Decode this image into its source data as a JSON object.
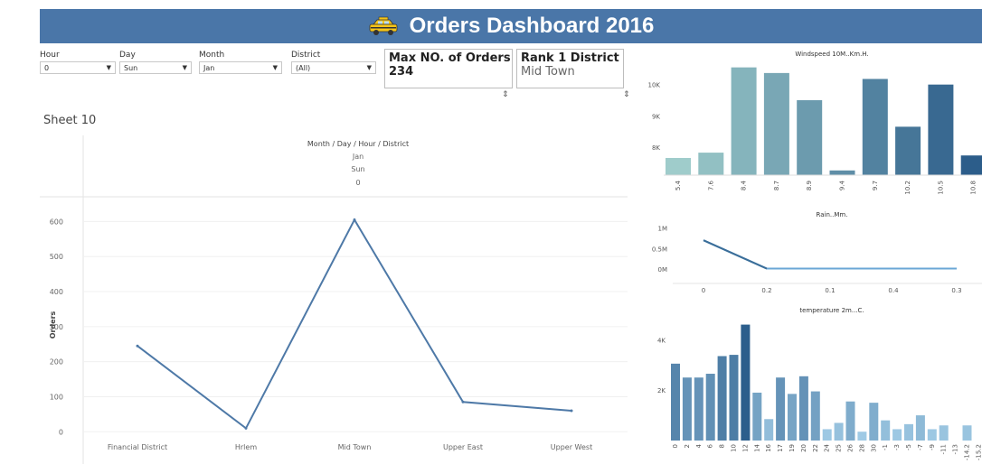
{
  "dashboard_title": "Orders Dashboard 2016",
  "filters": [
    {
      "label": "Hour",
      "value": "0"
    },
    {
      "label": "Day",
      "value": "Sun"
    },
    {
      "label": "Month",
      "value": "Jan"
    },
    {
      "label": "District",
      "value": "(All)"
    }
  ],
  "kpi": {
    "max_orders_title": "Max NO. of Orders",
    "max_orders_value": "234",
    "rank1_title": "Rank 1 District",
    "rank1_value": "Mid Town"
  },
  "sheet_title": "Sheet 10",
  "colors": {
    "banner": "#4a76a8",
    "line": "#4e79a7",
    "ramp_light": "#b3e0d6",
    "ramp_dark": "#2c5d8a"
  },
  "chart_data": [
    {
      "type": "line",
      "title": "Month / Day / Hour / District",
      "headers": [
        "Jan",
        "Sun",
        "0"
      ],
      "ylabel": "Orders",
      "categories": [
        "Financial District",
        "Hrlem",
        "Mid Town",
        "Upper East",
        "Upper West"
      ],
      "values": [
        245,
        10,
        605,
        85,
        60
      ],
      "ylim": [
        -25,
        650
      ],
      "yticks": [
        0,
        100,
        200,
        300,
        400,
        500,
        600
      ]
    },
    {
      "type": "bar",
      "title": "Windspeed 10M..Km.H.",
      "categories": [
        "5.4",
        "7.6",
        "8.4",
        "8.7",
        "8.9",
        "9.4",
        "9.7",
        "10.2",
        "10.5",
        "10.8"
      ],
      "values": [
        7650,
        7820,
        10550,
        10370,
        9500,
        7250,
        10180,
        8650,
        10000,
        7730
      ],
      "ylim": [
        7100,
        10800
      ],
      "yticks": [
        {
          "v": 8000,
          "label": "8K"
        },
        {
          "v": 9000,
          "label": "9K"
        },
        {
          "v": 10000,
          "label": "10K"
        }
      ]
    },
    {
      "type": "line",
      "title": "Rain..Mm.",
      "categories": [
        "0",
        "0.2",
        "0.1",
        "0.4",
        "0.3"
      ],
      "values": [
        0.7,
        0.01,
        0.01,
        0.01,
        0.01
      ],
      "ylim": [
        0,
        1.1
      ],
      "yticks": [
        {
          "v": 0,
          "label": "0M"
        },
        {
          "v": 0.5,
          "label": "0.5M"
        },
        {
          "v": 1,
          "label": "1M"
        }
      ]
    },
    {
      "type": "bar",
      "title": "temperature 2m...C.",
      "categories": [
        "0",
        "2",
        "4",
        "6",
        "8",
        "10",
        "12",
        "14",
        "16",
        "17",
        "19",
        "20",
        "22",
        "24",
        "25",
        "26",
        "28",
        "30",
        "-1",
        "-3",
        "-5",
        "-7",
        "-9",
        "-11",
        "-13",
        "-14.2",
        "-15.2"
      ],
      "values": [
        3050,
        2500,
        2500,
        2650,
        3350,
        3400,
        4600,
        1900,
        850,
        2500,
        1850,
        2550,
        1950,
        450,
        700,
        1550,
        350,
        1500,
        800,
        450,
        650,
        1000,
        450,
        600,
        0,
        600,
        0
      ],
      "ylim": [
        0,
        4800
      ],
      "yticks": [
        {
          "v": 2000,
          "label": "2K"
        },
        {
          "v": 4000,
          "label": "4K"
        }
      ]
    }
  ]
}
